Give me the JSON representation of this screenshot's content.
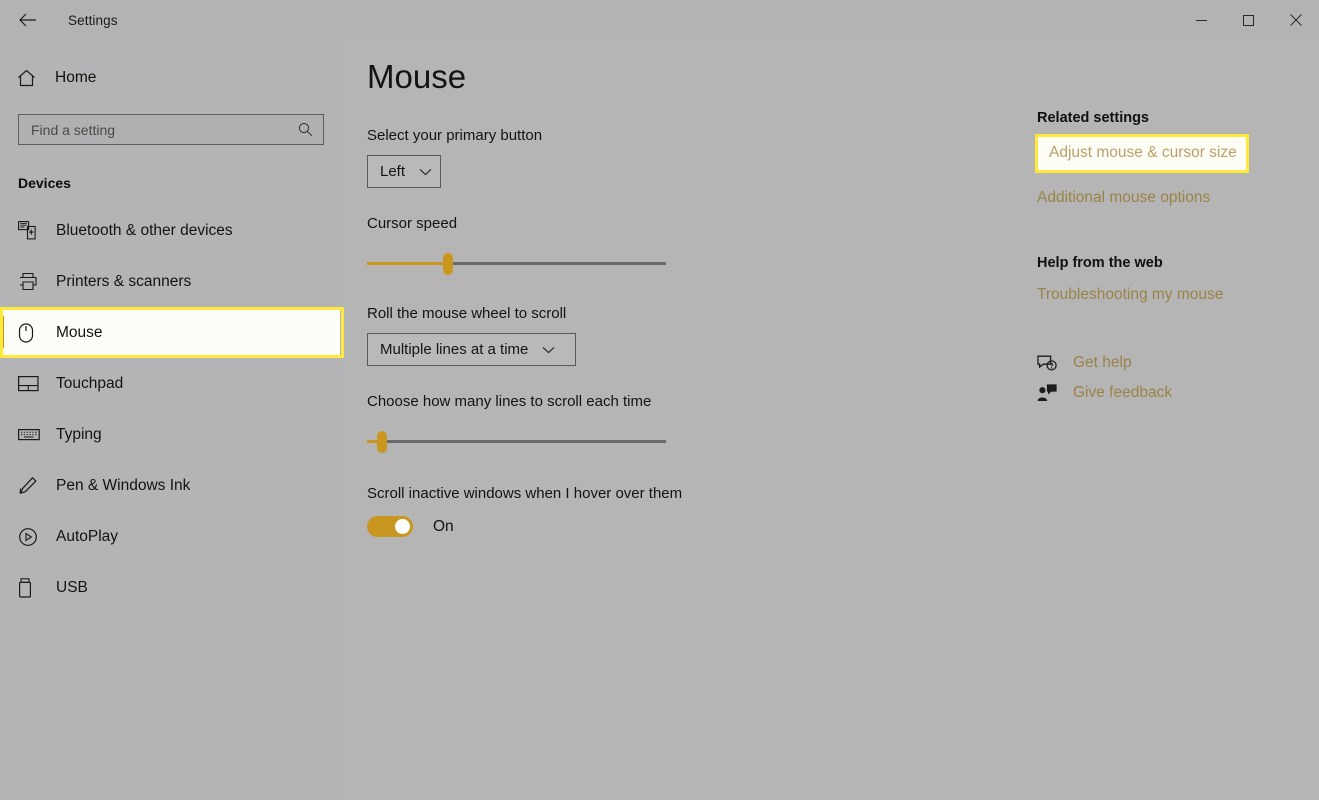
{
  "window": {
    "title": "Settings",
    "back_icon": "back-arrow-icon",
    "controls": [
      {
        "name": "minimize-button",
        "glyph": "─"
      },
      {
        "name": "maximize-button",
        "glyph": "□"
      },
      {
        "name": "close-button",
        "glyph": "✕"
      }
    ]
  },
  "sidebar": {
    "home_label": "Home",
    "home_icon": "home-icon",
    "search": {
      "placeholder": "Find a setting",
      "value": "",
      "icon": "search-icon"
    },
    "group_header": "Devices",
    "items": [
      {
        "label": "Bluetooth & other devices",
        "icon": "bluetooth-devices-icon",
        "selected": false
      },
      {
        "label": "Printers & scanners",
        "icon": "printer-icon",
        "selected": false
      },
      {
        "label": "Mouse",
        "icon": "mouse-icon",
        "selected": true
      },
      {
        "label": "Touchpad",
        "icon": "touchpad-icon",
        "selected": false
      },
      {
        "label": "Typing",
        "icon": "keyboard-icon",
        "selected": false
      },
      {
        "label": "Pen & Windows Ink",
        "icon": "pen-icon",
        "selected": false
      },
      {
        "label": "AutoPlay",
        "icon": "autoplay-icon",
        "selected": false
      },
      {
        "label": "USB",
        "icon": "usb-icon",
        "selected": false
      }
    ]
  },
  "main": {
    "title": "Mouse",
    "primary_button": {
      "label": "Select your primary button",
      "value": "Left",
      "chevron_icon": "chevron-down-icon"
    },
    "cursor_speed": {
      "label": "Cursor speed",
      "percent": 27
    },
    "wheel_scroll": {
      "label": "Roll the mouse wheel to scroll",
      "value": "Multiple lines at a time",
      "chevron_icon": "chevron-down-icon"
    },
    "lines_to_scroll": {
      "label": "Choose how many lines to scroll each time",
      "percent": 5
    },
    "inactive_scroll": {
      "label": "Scroll inactive windows when I hover over them",
      "state": "On"
    }
  },
  "right_panel": {
    "related_header": "Related settings",
    "related_links": [
      {
        "label": "Adjust mouse & cursor size",
        "highlighted": true
      },
      {
        "label": "Additional mouse options",
        "highlighted": false
      }
    ],
    "help_header": "Help from the web",
    "help_links": [
      {
        "label": "Troubleshooting my mouse"
      }
    ],
    "actions": [
      {
        "label": "Get help",
        "icon": "help-bubble-icon"
      },
      {
        "label": "Give feedback",
        "icon": "feedback-person-icon"
      }
    ]
  },
  "colors": {
    "accent": "#c9971f",
    "highlight": "#ffe93a",
    "sidebar_bg": "#b4b4b6",
    "content_bg": "#b5b5b5",
    "link": "#9a8348"
  }
}
